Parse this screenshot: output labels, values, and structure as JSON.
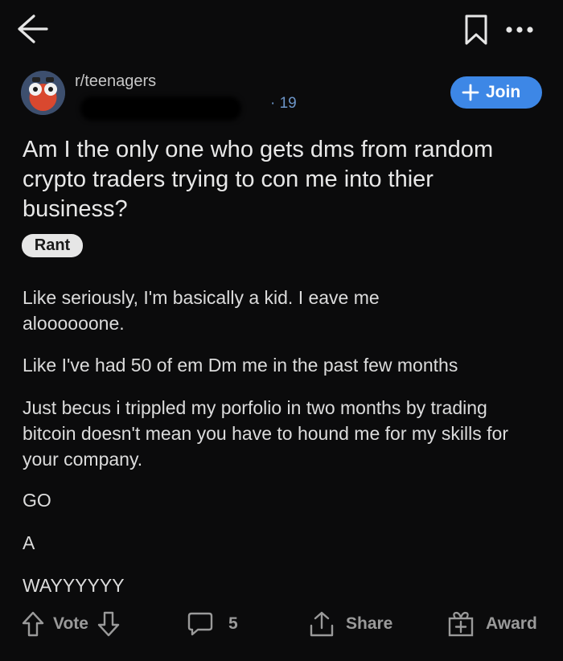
{
  "header": {
    "back_icon": "arrow-left-icon",
    "bookmark_icon": "bookmark-icon",
    "more_icon": "more-dots-icon"
  },
  "post": {
    "subreddit": "r/teenagers",
    "time_ago": "· 19",
    "join_label": "Join",
    "title": "Am I the only one who gets dms from random crypto traders trying to con me into thier business?",
    "flair": "Rant",
    "paragraphs": [
      "Like seriously, I'm basically a kid. I eave me aloooooone.",
      "Like I've had 50 of em Dm me in the past few months",
      "Just becus i trippled my porfolio in two months by trading bitcoin doesn't mean you have to hound me for my skills for your company.",
      "GO",
      "A",
      "WAYYYYYY"
    ]
  },
  "action_bar": {
    "vote_label": "Vote",
    "comment_count": "5",
    "share_label": "Share",
    "award_label": "Award"
  },
  "colors": {
    "background": "#0b0b0c",
    "accent": "#3d87e6",
    "text": "#e3e3e3",
    "muted": "#9a9a9a"
  }
}
